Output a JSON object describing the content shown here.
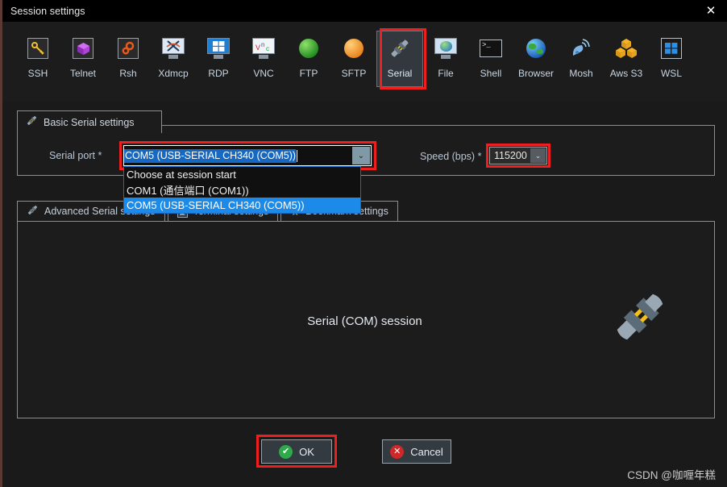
{
  "window": {
    "title": "Session settings",
    "close_label": "✕"
  },
  "toolbar": {
    "items": [
      {
        "label": "SSH",
        "icon": "key-icon"
      },
      {
        "label": "Telnet",
        "icon": "cube-icon"
      },
      {
        "label": "Rsh",
        "icon": "gears-icon"
      },
      {
        "label": "Xdmcp",
        "icon": "x-monitor-icon"
      },
      {
        "label": "RDP",
        "icon": "windows-monitor-icon"
      },
      {
        "label": "VNC",
        "icon": "vnc-monitor-icon"
      },
      {
        "label": "FTP",
        "icon": "green-globe-icon"
      },
      {
        "label": "SFTP",
        "icon": "orange-globe-icon"
      },
      {
        "label": "Serial",
        "icon": "serial-plug-icon",
        "selected": true
      },
      {
        "label": "File",
        "icon": "file-monitor-icon"
      },
      {
        "label": "Shell",
        "icon": "terminal-icon"
      },
      {
        "label": "Browser",
        "icon": "blue-globe-icon"
      },
      {
        "label": "Mosh",
        "icon": "satellite-dish-icon"
      },
      {
        "label": "Aws S3",
        "icon": "aws-cubes-icon"
      },
      {
        "label": "WSL",
        "icon": "windows-icon"
      }
    ]
  },
  "basic_panel": {
    "tab_label": "Basic Serial settings",
    "serial_port": {
      "label": "Serial port *",
      "value": "COM5  (USB-SERIAL CH340 (COM5))",
      "arrow": "⌄",
      "options": [
        {
          "label": "Choose at session start",
          "selected": false
        },
        {
          "label": "COM1  (通信端口 (COM1))",
          "selected": false
        },
        {
          "label": "COM5  (USB-SERIAL CH340 (COM5))",
          "selected": true
        }
      ]
    },
    "speed": {
      "label": "Speed (bps) *",
      "value": "115200",
      "arrow": "⌄"
    }
  },
  "tabs2": [
    {
      "label": "Advanced Serial settings",
      "icon": "serial-plug-icon"
    },
    {
      "label": "Terminal settings",
      "icon": "terminal-settings-icon"
    },
    {
      "label": "Bookmark settings",
      "icon": "star-icon"
    }
  ],
  "main_panel": {
    "session_text": "Serial (COM) session",
    "illustration": "serial-plug-large-icon"
  },
  "footer": {
    "ok_label": "OK",
    "ok_badge": "✔",
    "cancel_label": "Cancel",
    "cancel_badge": "✕"
  },
  "watermark": "CSDN @咖喱年糕",
  "colors": {
    "accent_red": "#f01f1f",
    "select_blue": "#1c8ae8",
    "panel_border": "#8d8d8d",
    "background": "#1a1a1a",
    "title_bar": "#000000"
  }
}
